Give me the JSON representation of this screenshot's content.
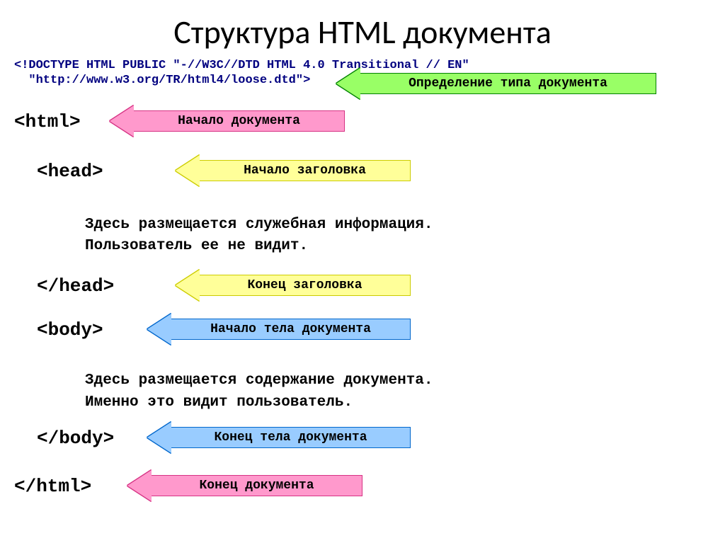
{
  "title": "Структура HTML документа",
  "doctype_line1": "<!DOCTYPE HTML PUBLIC \"-//W3C//DTD HTML 4.0 Transitional // EN\"",
  "doctype_line2": "  \"http://www.w3.org/TR/html4/loose.dtd\">",
  "tags": {
    "html_open": "<html>",
    "head_open": "<head>",
    "head_close": "</head>",
    "body_open": "<body>",
    "body_close": "</body>",
    "html_close": "</html>"
  },
  "notes": {
    "head_note_l1": "Здесь размещается служебная информация.",
    "head_note_l2": "Пользователь ее не видит.",
    "body_note_l1": "Здесь размещается содержание документа.",
    "body_note_l2": "Именно это видит пользователь."
  },
  "arrows": {
    "doctype": "Определение типа документа",
    "html_open": "Начало документа",
    "head_open": "Начало заголовка",
    "head_close": "Конец заголовка",
    "body_open": "Начало тела документа",
    "body_close": "Конец тела документа",
    "html_close": "Конец документа"
  }
}
